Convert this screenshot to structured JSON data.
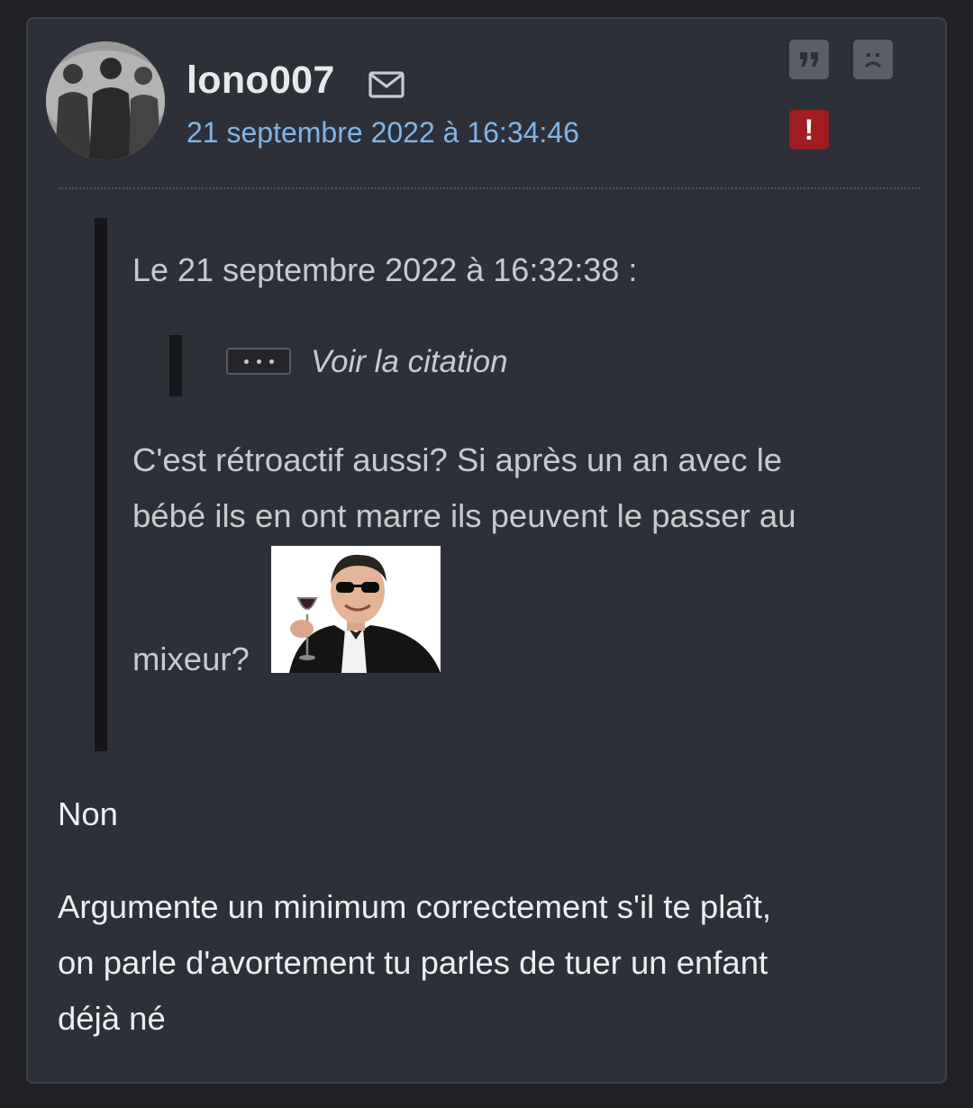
{
  "post": {
    "author": "lono007",
    "timestamp": "21 septembre 2022 à 16:34:46",
    "icons": {
      "mail": "envelope-icon",
      "quote": "quote-icon",
      "sad": "sad-face-icon",
      "report": "exclamation-icon"
    },
    "report_symbol": "!",
    "quote_symbol": "99"
  },
  "quote": {
    "header": "Le 21 septembre 2022 à 16:32:38 :",
    "nested_toggle_label": "Voir la citation",
    "lines": [
      "C'est rétroactif aussi? Si après un an avec le",
      "bébé ils en ont marre ils peuvent le passer au",
      "mixeur?"
    ],
    "sticker": "sticker-man-sunglasses-wine-glass"
  },
  "reply": {
    "lines": [
      "Non",
      "Argumente un minimum correctement s'il te plaît,",
      "on parle d'avortement tu parles de tuer un enfant",
      "déjà né"
    ]
  },
  "colors": {
    "background": "#1f2127",
    "card": "#2d3038",
    "link": "#7fb6e8",
    "report": "#a01c20",
    "quote_bar": "#15161a"
  }
}
